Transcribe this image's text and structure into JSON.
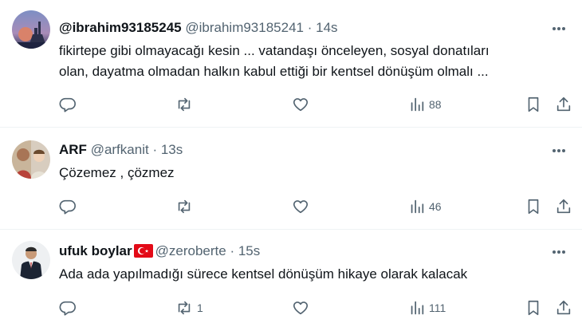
{
  "tweets": [
    {
      "display_name": "@ibrahim93185245",
      "handle": "@ibrahim93185241",
      "separator": "·",
      "time": "14s",
      "lines": [
        "fikirtepe gibi olmayacağı kesin ... vatandaşı önceleyen, sosyal donatıları",
        "olan, dayatma olmadan halkın kabul ettiği bir kentsel dönüşüm olmalı ..."
      ],
      "retweets": "",
      "views": "88"
    },
    {
      "display_name": "ARF",
      "handle": "@arfkanit",
      "separator": "·",
      "time": "13s",
      "lines": [
        "Çözemez , çözmez"
      ],
      "retweets": "",
      "views": "46"
    },
    {
      "display_name": "ufuk boylar",
      "handle": "@zeroberte",
      "separator": "·",
      "time": "15s",
      "lines": [
        "Ada ada yapılmadığı sürece kentsel dönüşüm hikaye olarak kalacak"
      ],
      "retweets": "1",
      "views": "111"
    }
  ],
  "icons": {
    "more": "more-options-icon",
    "reply": "reply-icon",
    "retweet": "retweet-icon",
    "like": "like-icon",
    "views": "views-chart-icon",
    "bookmark": "bookmark-icon",
    "share": "share-icon",
    "flag": "turkey-flag-icon"
  },
  "colors": {
    "text": "#0f1419",
    "secondary": "#536471",
    "divider": "#eff3f4",
    "flag_red": "#e30a17"
  }
}
